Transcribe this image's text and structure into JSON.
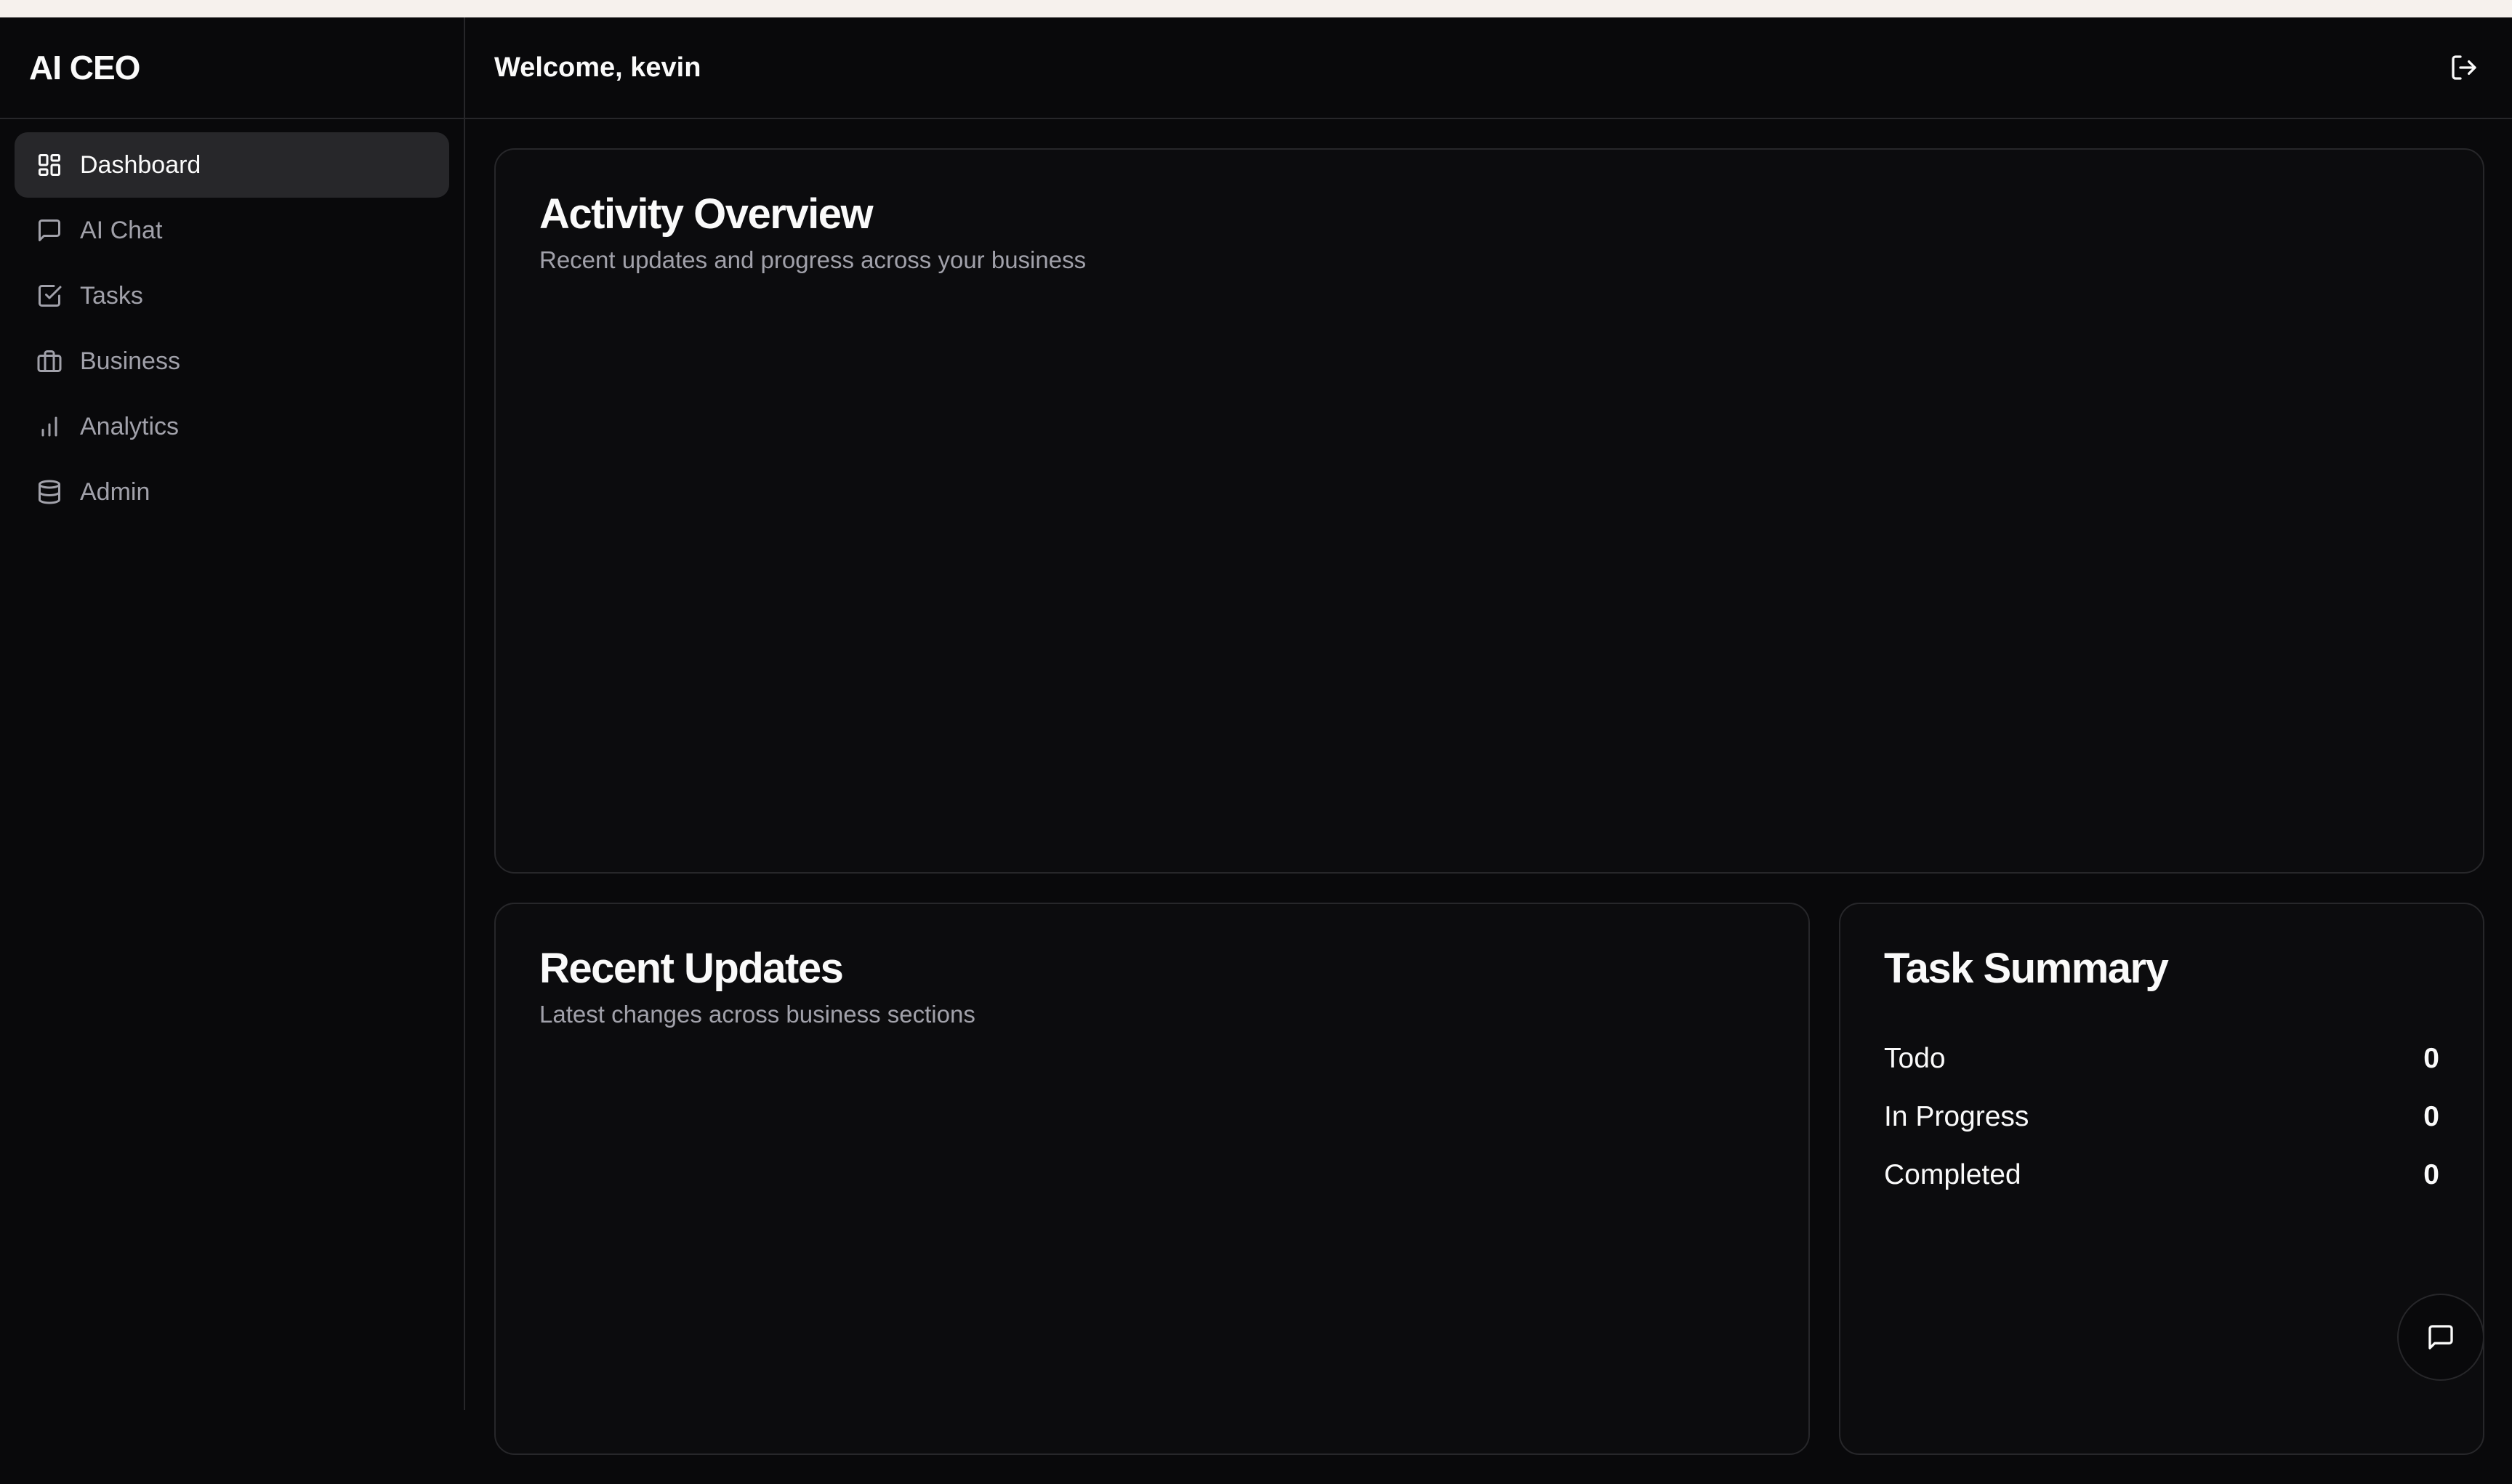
{
  "app": {
    "brand": "AI CEO"
  },
  "sidebar": {
    "items": [
      {
        "label": "Dashboard",
        "icon": "layout-dashboard-icon",
        "active": true
      },
      {
        "label": "AI Chat",
        "icon": "message-square-icon",
        "active": false
      },
      {
        "label": "Tasks",
        "icon": "check-square-icon",
        "active": false
      },
      {
        "label": "Business",
        "icon": "briefcase-icon",
        "active": false
      },
      {
        "label": "Analytics",
        "icon": "bar-chart-icon",
        "active": false
      },
      {
        "label": "Admin",
        "icon": "database-icon",
        "active": false
      }
    ]
  },
  "header": {
    "welcome": "Welcome, kevin",
    "logout_icon": "log-out-icon"
  },
  "activity": {
    "title": "Activity Overview",
    "description": "Recent updates and progress across your business"
  },
  "updates": {
    "title": "Recent Updates",
    "description": "Latest changes across business sections"
  },
  "summary": {
    "title": "Task Summary",
    "rows": [
      {
        "label": "Todo",
        "value": "0"
      },
      {
        "label": "In Progress",
        "value": "0"
      },
      {
        "label": "Completed",
        "value": "0"
      }
    ]
  },
  "colors": {
    "background": "#09090b",
    "border": "#27272a",
    "active_nav": "#27272a",
    "muted_text": "#a1a1aa",
    "foreground": "#fafafa"
  }
}
